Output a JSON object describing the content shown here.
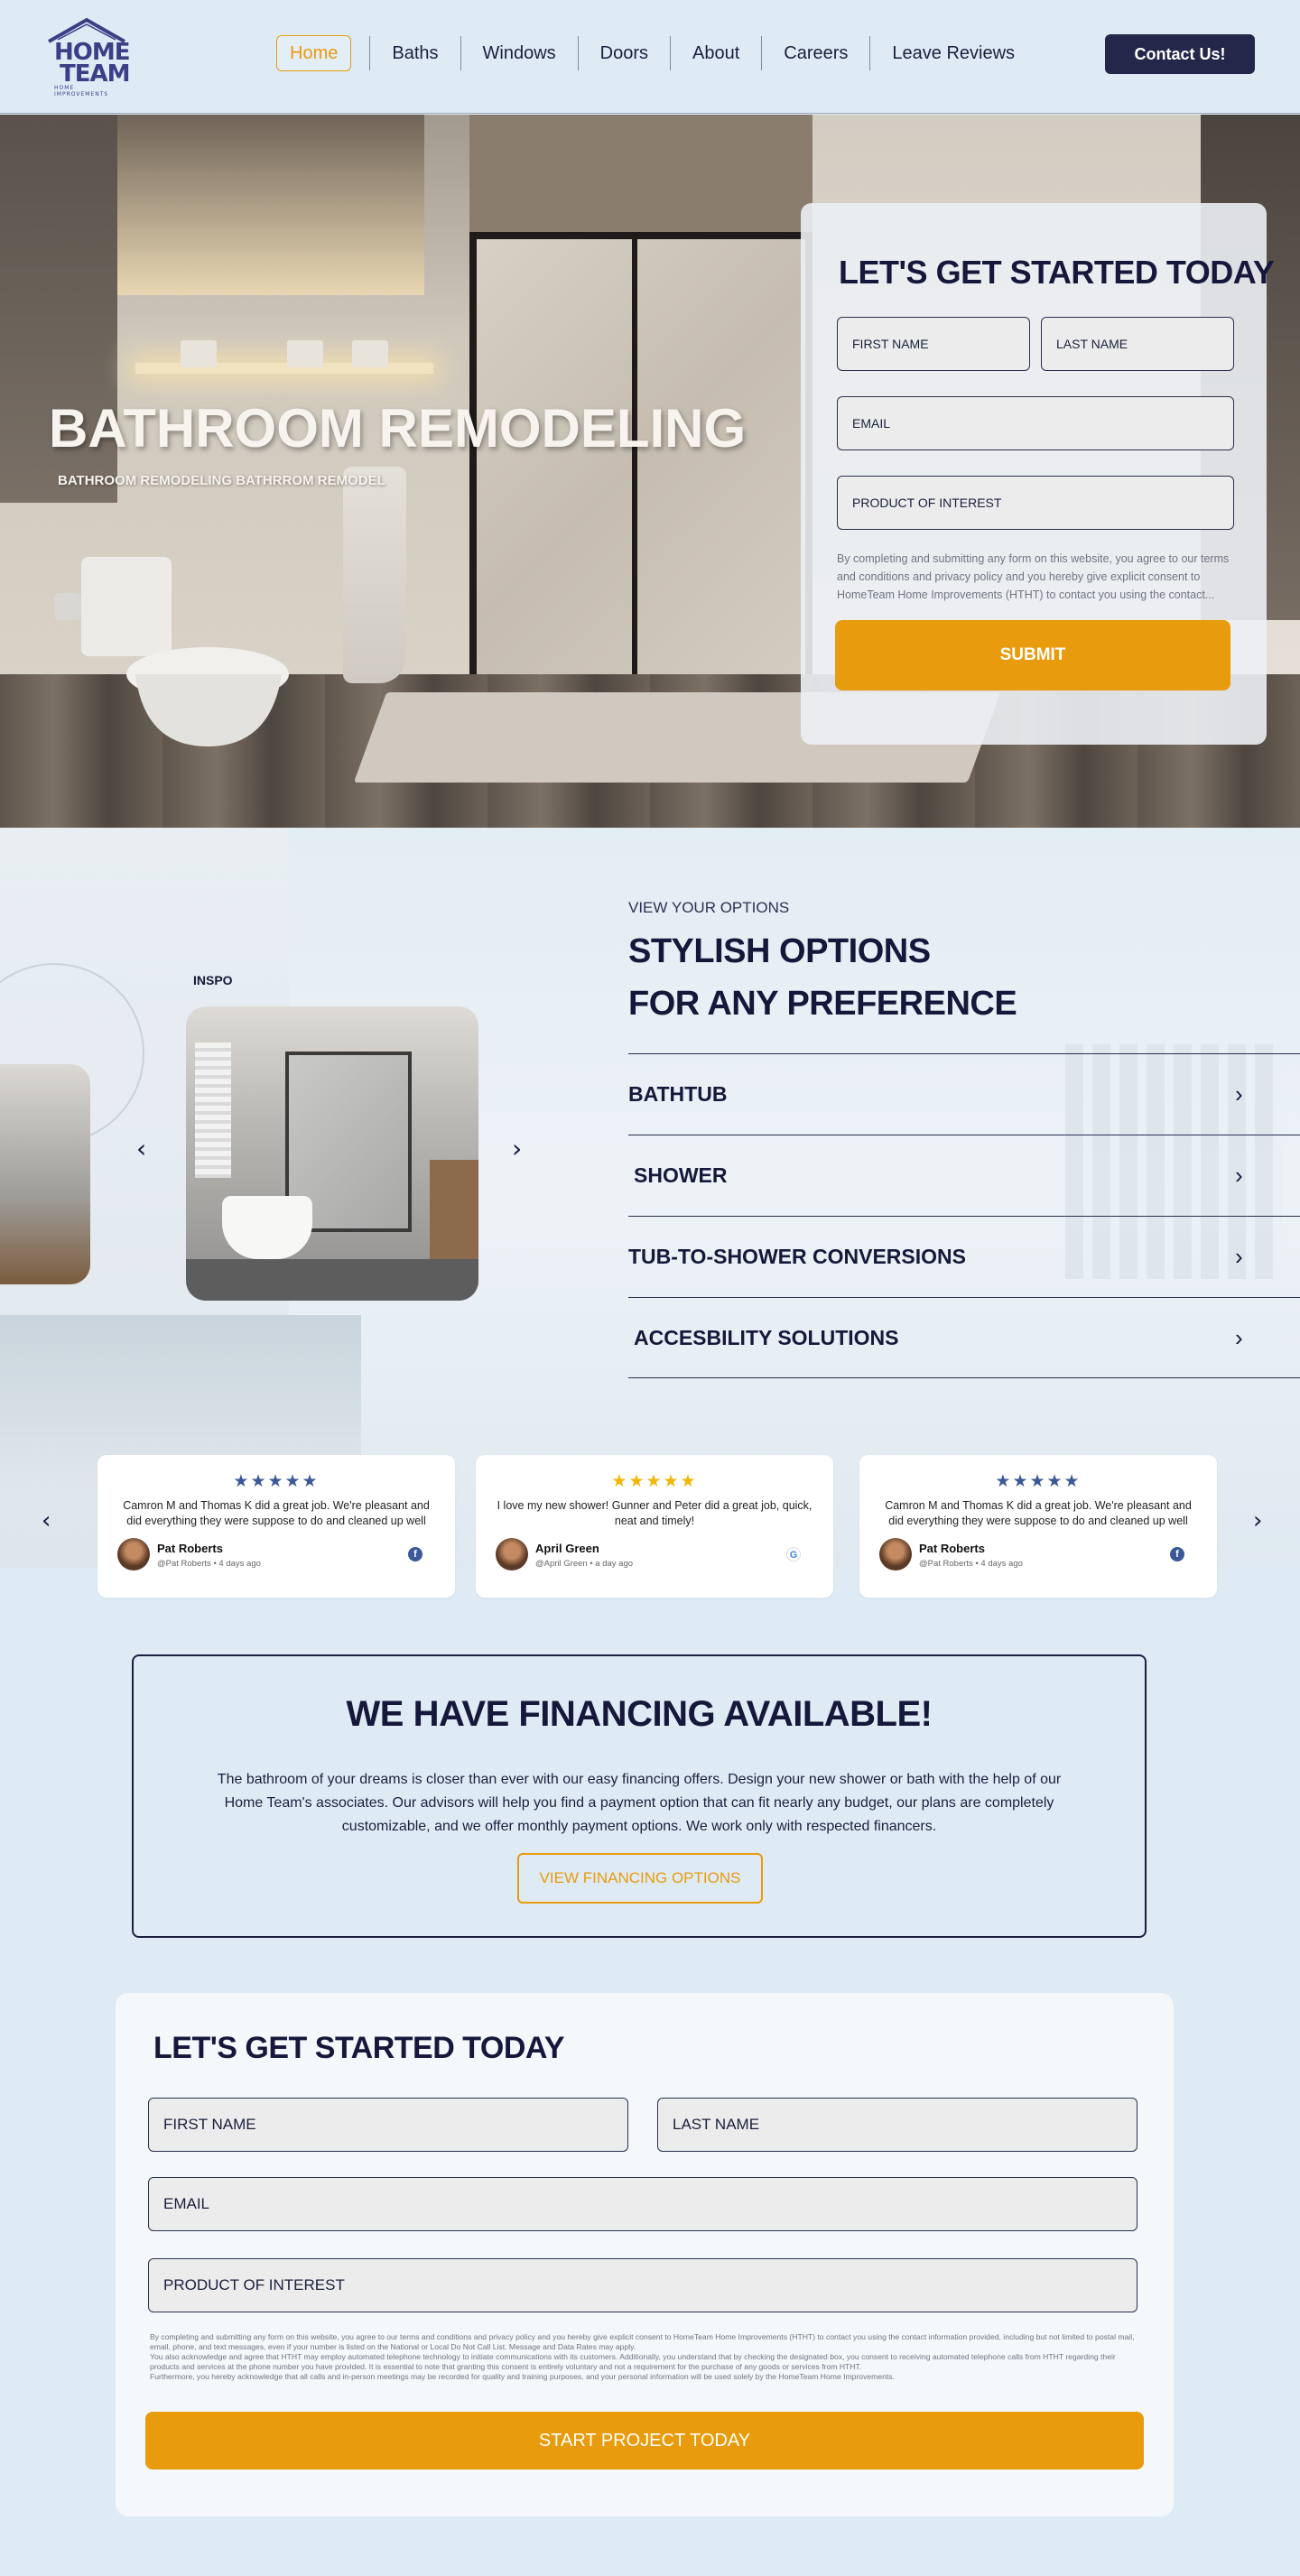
{
  "brand": {
    "logo_line1": "HOME",
    "logo_line2": "TEAM",
    "logo_tagline": "HOME IMPROVEMENTS"
  },
  "nav": {
    "items": [
      "Home",
      "Baths",
      "Windows",
      "Doors",
      "About",
      "Careers",
      "Leave Reviews"
    ],
    "active": "Home",
    "contact_label": "Contact Us!"
  },
  "hero": {
    "title": "BATHROOM REMODELING",
    "subtitle": "BATHROOM REMODELING BATHRROM REMODEL",
    "form": {
      "heading": "LET'S GET STARTED TODAY",
      "first_name": "FIRST NAME",
      "last_name": "LAST NAME",
      "email": "EMAIL",
      "product": "PRODUCT OF INTEREST",
      "disclaimer": "By completing and submitting any form on this website, you agree to our terms and conditions and privacy policy and you hereby give explicit consent to HomeTeam Home Improvements (HTHT) to contact you using the contact...",
      "submit_label": "SUBMIT"
    }
  },
  "options": {
    "inspo_label": "INSPO",
    "eyebrow": "VIEW YOUR OPTIONS",
    "title_line1": "STYLISH OPTIONS",
    "title_line2": "FOR ANY PREFERENCE",
    "items": [
      "BATHTUB",
      "SHOWER",
      "TUB-TO-SHOWER CONVERSIONS",
      "ACCESBILITY SOLUTIONS"
    ],
    "prev_icon": "chevron-left-icon",
    "next_icon": "chevron-right-icon"
  },
  "reviews": [
    {
      "stars": "★★★★★",
      "star_color": "#3b5998",
      "text": "Camron M and Thomas K did a great job. We're pleasant and did everything they were suppose to do and cleaned up well",
      "name": "Pat Roberts",
      "meta": "@Pat Roberts • 4 days ago",
      "source": "facebook-icon",
      "source_glyph": "f",
      "source_color": "#3b5998"
    },
    {
      "stars": "★★★★★",
      "star_color": "#f2b705",
      "text": "I love my new shower! Gunner and Peter did a great job, quick, neat and timely!",
      "name": "April Green",
      "meta": "@April Green • a day ago",
      "source": "google-icon",
      "source_glyph": "G",
      "source_color": "#4285f4"
    },
    {
      "stars": "★★★★★",
      "star_color": "#3b5998",
      "text": "Camron M and Thomas K did a great job. We're pleasant and did everything they were suppose to do and cleaned up well",
      "name": "Pat Roberts",
      "meta": "@Pat Roberts • 4 days ago",
      "source": "facebook-icon",
      "source_glyph": "f",
      "source_color": "#3b5998"
    }
  ],
  "financing": {
    "heading": "WE HAVE FINANCING AVAILABLE!",
    "body": "The bathroom of your dreams is closer than ever with our easy financing offers.  Design your new shower or bath with the help of our Home Team's associates. Our advisors will help you find a payment option that can fit nearly any budget, our plans are completely customizable, and we offer monthly payment options. We work only with respected financers.",
    "button_label": "VIEW FINANCING OPTIONS"
  },
  "bottom_form": {
    "heading": "LET'S GET STARTED TODAY",
    "first_name": "FIRST NAME",
    "last_name": "LAST NAME",
    "email": "EMAIL",
    "product": "PRODUCT OF INTEREST",
    "disclaimer_1": "By completing and submitting any form on this website, you agree to our terms and conditions and privacy policy and you hereby give explicit consent to HomeTeam Home Improvements (HTHT) to contact you using the contact information provided, including but not limited to postal mail, email, phone, and text messages, even if your number is listed on the National or Local Do Not Call List. Message and Data Rates may apply.",
    "disclaimer_2": "You also acknowledge and agree that HTHT may employ automated telephone technology to initiate communications with its customers. Additionally, you understand that by checking the designated box, you consent to receiving automated telephone calls from HTHT regarding their products and services at the phone number you have provided. It is essential to note that granting this consent is entirely voluntary and not a requirement for the purchase of any goods or services from HTHT.",
    "disclaimer_3": "Furthermore, you hereby acknowledge that all calls and in-person meetings may be recorded for quality and training purposes, and your personal information will be used solely by the HomeTeam Home Improvements.",
    "button_label": "START PROJECT TODAY"
  },
  "colors": {
    "accent": "#e89b0c",
    "navy": "#23274a",
    "background": "#deebf5"
  }
}
